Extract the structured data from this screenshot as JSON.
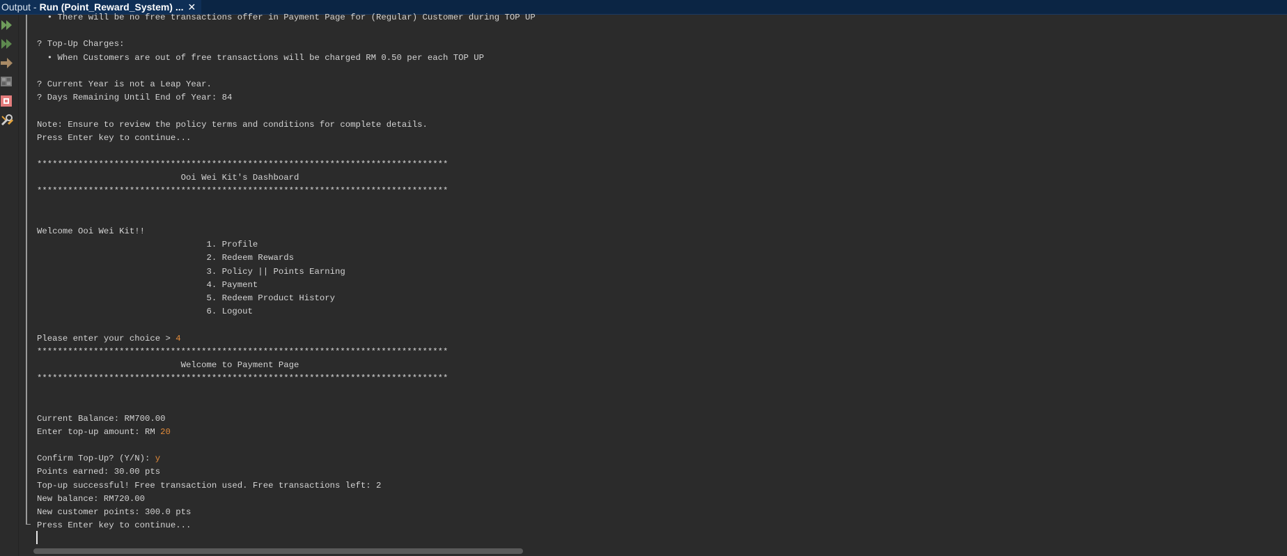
{
  "tab": {
    "prefix": "Output - ",
    "name": "Run (Point_Reward_System) ..."
  },
  "toolbar": {
    "icons": [
      "rerun-icon",
      "rerun-with-options-icon",
      "step-icon",
      "settings-icon",
      "stop-icon",
      "tools-icon"
    ]
  },
  "console": {
    "lines": [
      {
        "text": "  • There will be no free transactions offer in Payment Page for (Regular) Customer during TOP UP"
      },
      {
        "text": ""
      },
      {
        "text": "? Top-Up Charges:"
      },
      {
        "text": "  • When Customers are out of free transactions will be charged RM 0.50 per each TOP UP"
      },
      {
        "text": ""
      },
      {
        "text": "? Current Year is not a Leap Year."
      },
      {
        "text": "? Days Remaining Until End of Year: 84"
      },
      {
        "text": ""
      },
      {
        "text": "Note: Ensure to review the policy terms and conditions for complete details."
      },
      {
        "text": "Press Enter key to continue..."
      },
      {
        "text": ""
      },
      {
        "text": "********************************************************************************"
      },
      {
        "text": "                            Ooi Wei Kit's Dashboard"
      },
      {
        "text": "********************************************************************************"
      },
      {
        "text": ""
      },
      {
        "text": ""
      },
      {
        "text": "Welcome Ooi Wei Kit!!"
      },
      {
        "text": "                                 1. Profile"
      },
      {
        "text": "                                 2. Redeem Rewards"
      },
      {
        "text": "                                 3. Policy || Points Earning"
      },
      {
        "text": "                                 4. Payment"
      },
      {
        "text": "                                 5. Redeem Product History"
      },
      {
        "text": "                                 6. Logout"
      },
      {
        "text": ""
      },
      {
        "text": "Please enter your choice > ",
        "input": "4"
      },
      {
        "text": "********************************************************************************"
      },
      {
        "text": "                            Welcome to Payment Page"
      },
      {
        "text": "********************************************************************************"
      },
      {
        "text": ""
      },
      {
        "text": ""
      },
      {
        "text": "Current Balance: RM700.00"
      },
      {
        "text": "Enter top-up amount: RM ",
        "input": "20"
      },
      {
        "text": ""
      },
      {
        "text": "Confirm Top-Up? (Y/N): ",
        "input": "y"
      },
      {
        "text": "Points earned: 30.00 pts"
      },
      {
        "text": "Top-up successful! Free transaction used. Free transactions left: 2"
      },
      {
        "text": "New balance: RM720.00"
      },
      {
        "text": "New customer points: 300.0 pts"
      },
      {
        "text": "Press Enter key to continue..."
      }
    ]
  },
  "colors": {
    "background": "#2b2b2b",
    "text": "#d4d4d4",
    "user_input": "#e08a3a",
    "titlebar": "#0b2544"
  }
}
